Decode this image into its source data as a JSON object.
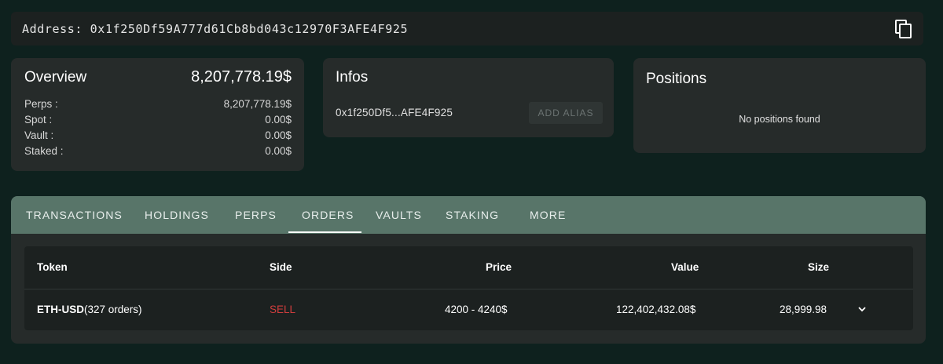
{
  "address": {
    "text": "Address: 0x1f250Df59A777d61Cb8bd043c12970F3AFE4F925"
  },
  "overview": {
    "title": "Overview",
    "total": "8,207,778.19$",
    "rows": [
      {
        "label": "Perps :",
        "value": "8,207,778.19$"
      },
      {
        "label": "Spot :",
        "value": "0.00$"
      },
      {
        "label": "Vault :",
        "value": "0.00$"
      },
      {
        "label": "Staked :",
        "value": "0.00$"
      }
    ]
  },
  "infos": {
    "title": "Infos",
    "short_address": "0x1f250Df5...AFE4F925",
    "alias_button": "ADD ALIAS"
  },
  "positions": {
    "title": "Positions",
    "empty_text": "No positions found"
  },
  "tabs": [
    "TRANSACTIONS",
    "HOLDINGS",
    "PERPS",
    "ORDERS",
    "VAULTS",
    "STAKING",
    "MORE"
  ],
  "active_tab": "ORDERS",
  "table": {
    "headers": [
      "Token",
      "Side",
      "Price",
      "Value",
      "Size"
    ],
    "rows": [
      {
        "token": "ETH-USD",
        "orders": "(327 orders)",
        "side": "SELL",
        "price": "4200 - 4240$",
        "value": "122,402,432.08$",
        "size": "28,999.98"
      }
    ]
  },
  "colors": {
    "background": "#0e211e",
    "card": "#262b2a",
    "tabbar": "#587569",
    "sell": "#d13d3d"
  },
  "icons": {
    "copy": "copy-icon",
    "expand": "chevron-down-icon"
  }
}
